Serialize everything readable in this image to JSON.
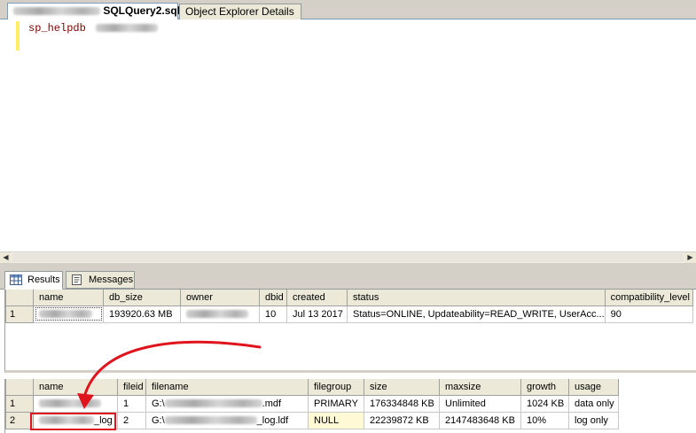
{
  "tabs": {
    "active_label": "SQLQuery2.sql*",
    "inactive_label": "Object Explorer Details"
  },
  "editor": {
    "code": "sp_helpdb"
  },
  "result_tabs": {
    "results_label": "Results",
    "messages_label": "Messages"
  },
  "db_grid": {
    "headers": [
      "name",
      "db_size",
      "owner",
      "dbid",
      "created",
      "status",
      "compatibility_level"
    ],
    "rows": [
      {
        "num": "1",
        "db_size": "193920.63 MB",
        "dbid": "10",
        "created": "Jul 13 2017",
        "status": "Status=ONLINE, Updateability=READ_WRITE, UserAcc...",
        "compatibility_level": "90"
      }
    ]
  },
  "file_grid": {
    "headers": [
      "name",
      "fileid",
      "filename",
      "filegroup",
      "size",
      "maxsize",
      "growth",
      "usage"
    ],
    "rows": [
      {
        "num": "1",
        "name_suffix": "",
        "fileid": "1",
        "filename_prefix": "G:\\",
        "filename_suffix": ".mdf",
        "filegroup": "PRIMARY",
        "size": "176334848 KB",
        "maxsize": "Unlimited",
        "growth": "1024 KB",
        "usage": "data only"
      },
      {
        "num": "2",
        "name_suffix": "_log",
        "fileid": "2",
        "filename_prefix": "G:\\",
        "filename_suffix": "_log.ldf",
        "filegroup": "NULL",
        "size": "22239872 KB",
        "maxsize": "2147483648 KB",
        "growth": "10%",
        "usage": "log only"
      }
    ]
  },
  "colors": {
    "annotation": "#e0141d",
    "keyword": "#800000"
  }
}
